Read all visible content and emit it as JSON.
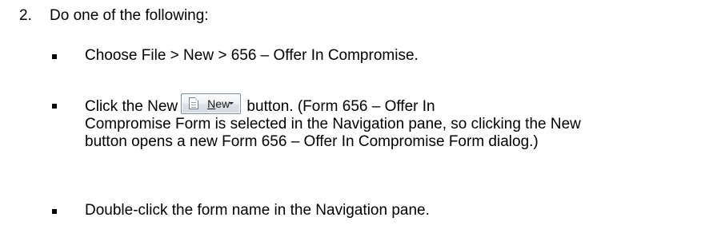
{
  "step": {
    "number": "2.",
    "text": "Do one of the following:"
  },
  "options": [
    {
      "text": "Choose File > New > 656 – Offer In Compromise."
    },
    {
      "before_button": "Click the New",
      "button": {
        "label_underlined": "N",
        "label_rest": "ew",
        "icon": "document-icon",
        "dropdown_icon": "dropdown-arrow-icon"
      },
      "after_button_first_line": " button. (Form 656 – Offer In",
      "rest": "Compromise Form is selected in the Navigation pane, so clicking the New button opens a new Form 656 – Offer In Compromise Form dialog.)"
    },
    {
      "text": "Double-click the form name in the Navigation pane."
    }
  ]
}
